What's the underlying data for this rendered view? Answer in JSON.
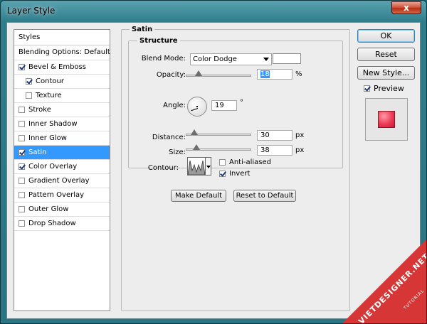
{
  "window": {
    "title": "Layer Style",
    "close_label": "x"
  },
  "styles_panel": {
    "header": "Styles",
    "blending": "Blending Options: Default",
    "items": [
      {
        "label": "Bevel & Emboss",
        "checked": true,
        "sub": false,
        "selected": false
      },
      {
        "label": "Contour",
        "checked": true,
        "sub": true,
        "selected": false
      },
      {
        "label": "Texture",
        "checked": false,
        "sub": true,
        "selected": false
      },
      {
        "label": "Stroke",
        "checked": false,
        "sub": false,
        "selected": false
      },
      {
        "label": "Inner Shadow",
        "checked": false,
        "sub": false,
        "selected": false
      },
      {
        "label": "Inner Glow",
        "checked": false,
        "sub": false,
        "selected": false
      },
      {
        "label": "Satin",
        "checked": true,
        "sub": false,
        "selected": true
      },
      {
        "label": "Color Overlay",
        "checked": true,
        "sub": false,
        "selected": false
      },
      {
        "label": "Gradient Overlay",
        "checked": false,
        "sub": false,
        "selected": false
      },
      {
        "label": "Pattern Overlay",
        "checked": false,
        "sub": false,
        "selected": false
      },
      {
        "label": "Outer Glow",
        "checked": false,
        "sub": false,
        "selected": false
      },
      {
        "label": "Drop Shadow",
        "checked": false,
        "sub": false,
        "selected": false
      }
    ]
  },
  "satin": {
    "title": "Satin",
    "structure_title": "Structure",
    "blend_mode": {
      "label": "Blend Mode:",
      "value": "Color Dodge",
      "swatch_color": "#ffffff"
    },
    "opacity": {
      "label": "Opacity:",
      "value": "18",
      "unit": "%",
      "level": 18
    },
    "angle": {
      "label": "Angle:",
      "value": "19",
      "unit": "°"
    },
    "distance": {
      "label": "Distance:",
      "value": "30",
      "unit": "px",
      "level": 12
    },
    "size": {
      "label": "Size:",
      "value": "38",
      "unit": "px",
      "level": 15
    },
    "contour": {
      "label": "Contour:"
    },
    "anti_aliased": {
      "label": "Anti-aliased",
      "checked": false
    },
    "invert": {
      "label": "Invert",
      "checked": true
    },
    "make_default": "Make Default",
    "reset_default": "Reset to Default"
  },
  "buttons": {
    "ok": "OK",
    "reset": "Reset",
    "new_style": "New Style...",
    "preview": "Preview",
    "preview_checked": true
  },
  "watermark": {
    "text": "VIETDESIGNER.NET",
    "sub": "TUTORIAL"
  }
}
